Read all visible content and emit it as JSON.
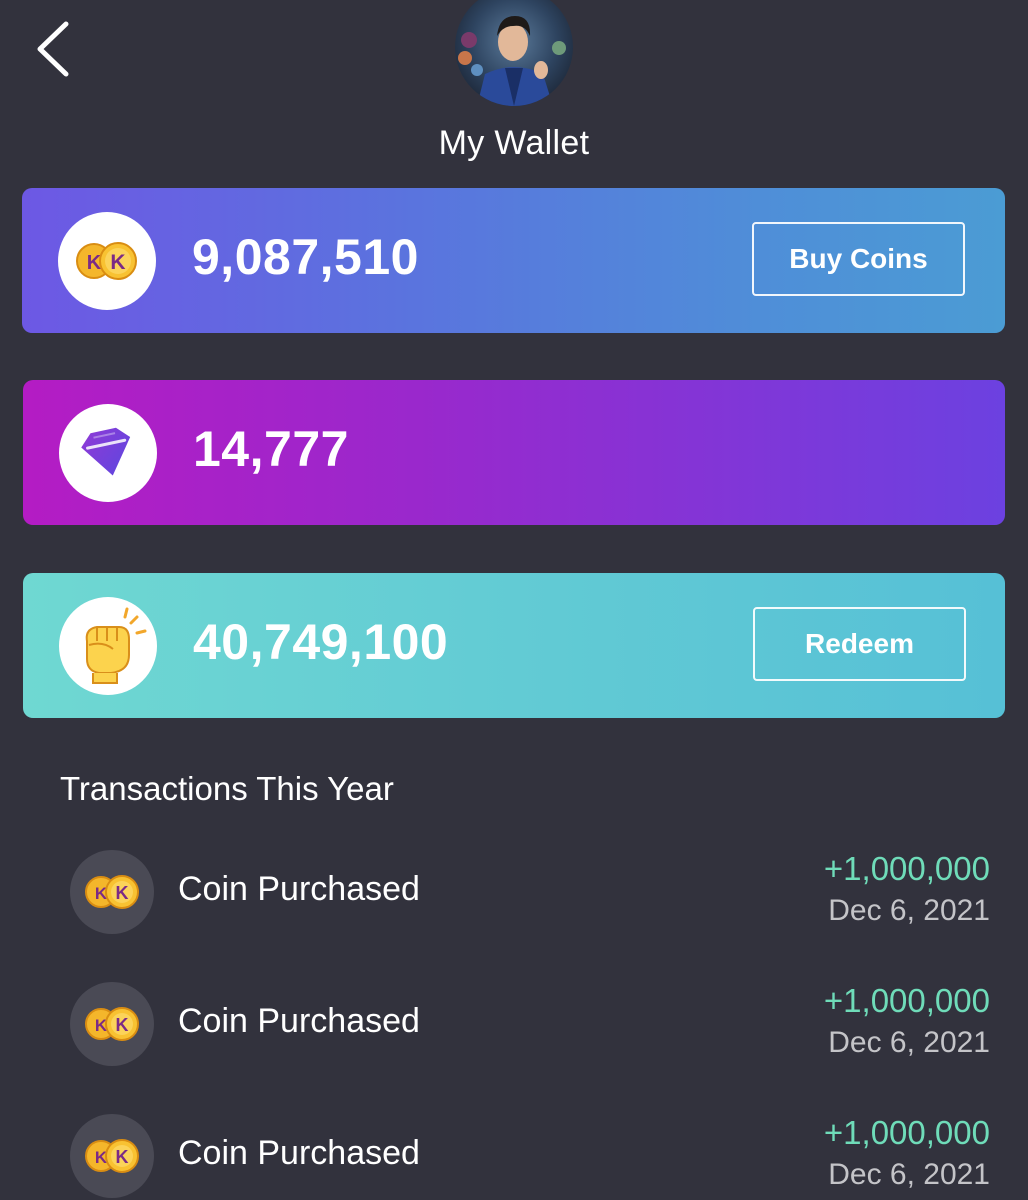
{
  "header": {
    "title": "My Wallet"
  },
  "balances": {
    "coins": {
      "amount": "9,087,510",
      "button_label": "Buy Coins"
    },
    "gems": {
      "amount": "14,777"
    },
    "rewards": {
      "amount": "40,749,100",
      "button_label": "Redeem"
    }
  },
  "transactions": {
    "title": "Transactions This Year",
    "items": [
      {
        "label": "Coin Purchased",
        "amount": "+1,000,000",
        "date": "Dec 6, 2021"
      },
      {
        "label": "Coin Purchased",
        "amount": "+1,000,000",
        "date": "Dec 6, 2021"
      },
      {
        "label": "Coin Purchased",
        "amount": "+1,000,000",
        "date": "Dec 6, 2021"
      }
    ]
  },
  "icons": {
    "back": "chevron-left-icon",
    "coins": "kk-coins-icon",
    "gems": "diamond-icon",
    "rewards": "fist-icon"
  },
  "colors": {
    "background": "#32323d",
    "positive_amount": "#6fdcb9"
  }
}
